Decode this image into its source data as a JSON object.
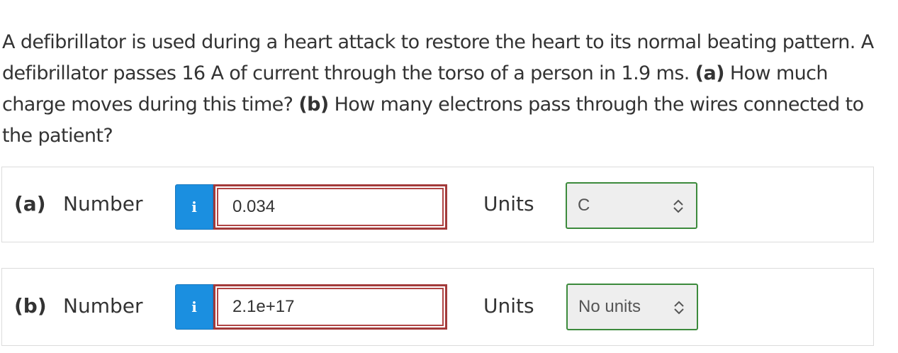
{
  "question": {
    "sentence1": "A defibrillator is used during a heart attack to restore the heart to its normal beating pattern. A defibrillator passes 16 A of current through the torso of a person in 1.9 ms. ",
    "part_a_marker": "(a)",
    "part_a_text": " How much charge moves during this time? ",
    "part_b_marker": "(b)",
    "part_b_text": " How many electrons pass through the wires connected to the patient?"
  },
  "parts": [
    {
      "label": "(a)",
      "number_label": "Number",
      "info_icon": "i",
      "answer_value": "0.034",
      "units_label": "Units",
      "units_value": "C"
    },
    {
      "label": "(b)",
      "number_label": "Number",
      "info_icon": "i",
      "answer_value": "2.1e+17",
      "units_label": "Units",
      "units_value": "No units"
    }
  ],
  "colors": {
    "info_button": "#1b8fe0",
    "answer_border_incorrect": "#a33a3a",
    "units_border_correct": "#3c8a3c"
  },
  "icons": {
    "info": "info-icon",
    "select_chevron": "chevron-up-down-icon"
  }
}
